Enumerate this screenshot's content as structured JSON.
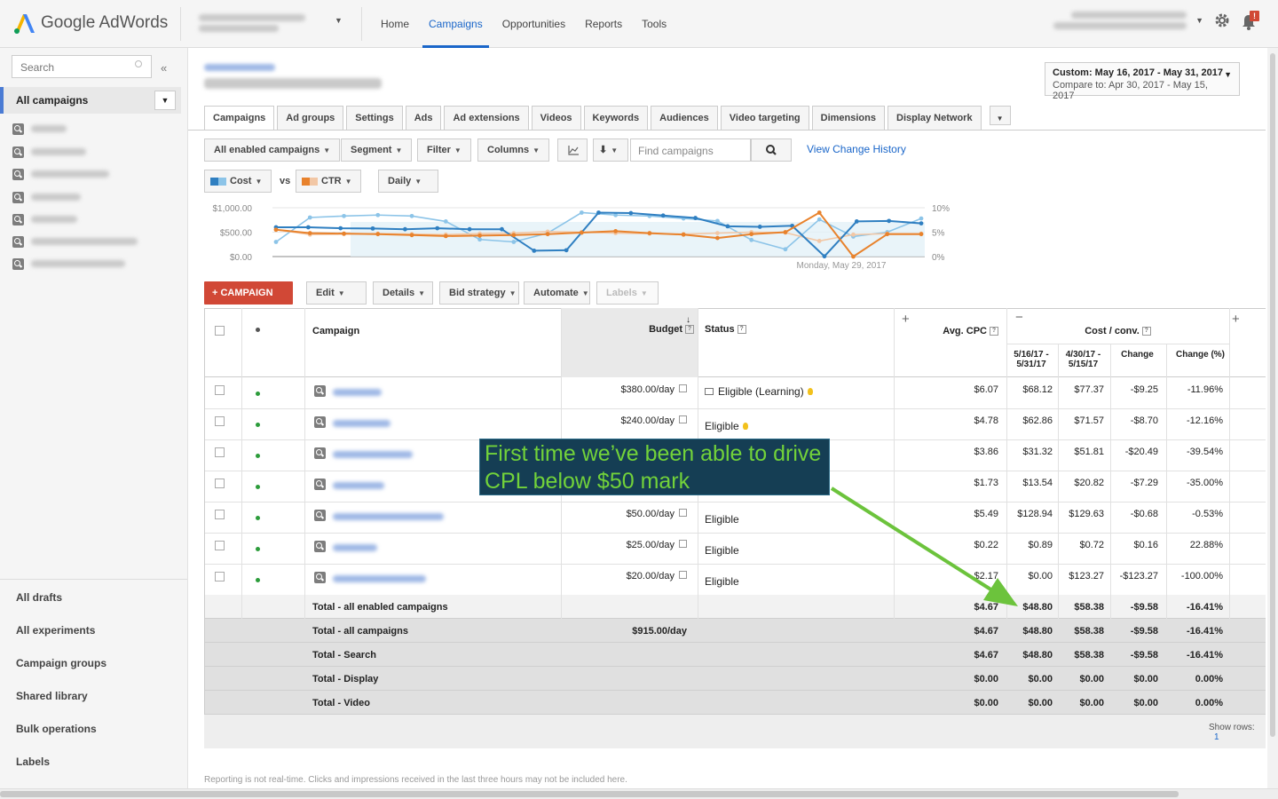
{
  "app": {
    "logo_text": "Google AdWords"
  },
  "nav": {
    "items": [
      "Home",
      "Campaigns",
      "Opportunities",
      "Reports",
      "Tools"
    ],
    "active": "Campaigns"
  },
  "notifications": {
    "badge": "!"
  },
  "sidebar": {
    "search_placeholder": "Search",
    "collapse_glyph": "«",
    "all_campaigns": "All campaigns",
    "bottom_links": [
      "All drafts",
      "All experiments",
      "Campaign groups",
      "Shared library",
      "Bulk operations",
      "Labels"
    ]
  },
  "daterange": {
    "primary": "Custom: May 16, 2017 - May 31, 2017",
    "compare": "Compare to: Apr 30, 2017 - May 15, 2017"
  },
  "tabs": [
    "Campaigns",
    "Ad groups",
    "Settings",
    "Ads",
    "Ad extensions",
    "Videos",
    "Keywords",
    "Audiences",
    "Video targeting",
    "Dimensions",
    "Display Network"
  ],
  "toolbar": {
    "filter_view": "All enabled campaigns",
    "segment": "Segment",
    "filter": "Filter",
    "columns": "Columns",
    "find_placeholder": "Find campaigns",
    "view_change_history": "View Change History",
    "metric1": "Cost",
    "vs": "vs",
    "metric2": "CTR",
    "period": "Daily"
  },
  "chart_data": {
    "type": "line",
    "yleft": {
      "ticks": [
        "$1,000.00",
        "$500.00",
        "$0.00"
      ],
      "range": [
        0,
        1000
      ]
    },
    "yright": {
      "ticks": [
        "10%",
        "5%",
        "0%"
      ],
      "range": [
        0,
        10
      ]
    },
    "x_label": "Monday, May 29, 2017",
    "series": [
      {
        "name": "Cost",
        "color": "#2f7fc1",
        "values": [
          600,
          600,
          580,
          575,
          560,
          580,
          560,
          560,
          120,
          130,
          900,
          890,
          840,
          790,
          620,
          610,
          630,
          5,
          720,
          730,
          680
        ]
      },
      {
        "name": "Cost (compare)",
        "color": "#8cc4e8",
        "values": [
          300,
          800,
          830,
          850,
          830,
          720,
          350,
          300,
          480,
          900,
          850,
          830,
          780,
          730,
          340,
          150,
          760,
          410,
          500,
          780
        ]
      },
      {
        "name": "CTR",
        "color": "#e8822c",
        "values": [
          5.5,
          4.8,
          4.7,
          4.6,
          4.4,
          4.2,
          4.3,
          4.4,
          4.6,
          4.9,
          5.2,
          4.8,
          4.5,
          3.8,
          4.6,
          5.0,
          9.0,
          0.0,
          4.6,
          4.6
        ]
      },
      {
        "name": "CTR (compare)",
        "color": "#f2c7a5",
        "values": [
          5.5,
          4.5,
          4.6,
          4.7,
          4.6,
          4.5,
          4.7,
          4.8,
          5.1,
          5.0,
          4.8,
          4.7,
          4.6,
          4.8,
          5.0,
          4.9,
          3.2,
          4.5,
          4.7,
          4.7
        ]
      }
    ]
  },
  "actions": {
    "new_campaign": "+ CAMPAIGN",
    "edit": "Edit",
    "details": "Details",
    "bid_strategy": "Bid strategy",
    "automate": "Automate",
    "labels": "Labels"
  },
  "table": {
    "headers": {
      "campaign": "Campaign",
      "budget": "Budget",
      "status": "Status",
      "avg_cpc": "Avg. CPC",
      "cost_conv": "Cost / conv.",
      "period1": "5/16/17 - 5/31/17",
      "period2": "4/30/17 - 5/15/17",
      "change": "Change",
      "change_pct": "Change (%)"
    },
    "rows": [
      {
        "budget": "$380.00/day",
        "status": "Eligible (Learning)",
        "cpc": "$6.07",
        "p1": "$68.12",
        "p2": "$77.37",
        "chg": "-$9.25",
        "pct": "-11.96%"
      },
      {
        "budget": "$240.00/day",
        "status": "Eligible",
        "cpc": "$4.78",
        "p1": "$62.86",
        "p2": "$71.57",
        "chg": "-$8.70",
        "pct": "-12.16%"
      },
      {
        "budget": "",
        "status": "",
        "cpc": "$3.86",
        "p1": "$31.32",
        "p2": "$51.81",
        "chg": "-$20.49",
        "pct": "-39.54%"
      },
      {
        "budget": "",
        "status": "",
        "cpc": "$1.73",
        "p1": "$13.54",
        "p2": "$20.82",
        "chg": "-$7.29",
        "pct": "-35.00%"
      },
      {
        "budget": "$50.00/day",
        "status": "Eligible",
        "cpc": "$5.49",
        "p1": "$128.94",
        "p2": "$129.63",
        "chg": "-$0.68",
        "pct": "-0.53%"
      },
      {
        "budget": "$25.00/day",
        "status": "Eligible",
        "cpc": "$0.22",
        "p1": "$0.89",
        "p2": "$0.72",
        "chg": "$0.16",
        "pct": "22.88%"
      },
      {
        "budget": "$20.00/day",
        "status": "Eligible",
        "cpc": "$2.17",
        "p1": "$0.00",
        "p2": "$123.27",
        "chg": "-$123.27",
        "pct": "-100.00%"
      }
    ],
    "totals": [
      {
        "label": "Total - all enabled campaigns",
        "budget": "",
        "cpc": "$4.67",
        "p1": "$48.80",
        "p2": "$58.38",
        "chg": "-$9.58",
        "pct": "-16.41%"
      },
      {
        "label": "Total - all campaigns",
        "budget": "$915.00/day",
        "cpc": "$4.67",
        "p1": "$48.80",
        "p2": "$58.38",
        "chg": "-$9.58",
        "pct": "-16.41%"
      },
      {
        "label": "Total - Search",
        "budget": "",
        "cpc": "$4.67",
        "p1": "$48.80",
        "p2": "$58.38",
        "chg": "-$9.58",
        "pct": "-16.41%"
      },
      {
        "label": "Total - Display",
        "budget": "",
        "cpc": "$0.00",
        "p1": "$0.00",
        "p2": "$0.00",
        "chg": "$0.00",
        "pct": "0.00%"
      },
      {
        "label": "Total - Video",
        "budget": "",
        "cpc": "$0.00",
        "p1": "$0.00",
        "p2": "$0.00",
        "chg": "$0.00",
        "pct": "0.00%"
      }
    ],
    "show_rows": "Show rows:",
    "show_rows_value": "1"
  },
  "callout": {
    "line1": "First time we’ve been able to drive",
    "line2": "CPL below $50 mark"
  },
  "footer": {
    "note": "Reporting is not real-time. Clicks and impressions received in the last three hours may not be included here."
  }
}
